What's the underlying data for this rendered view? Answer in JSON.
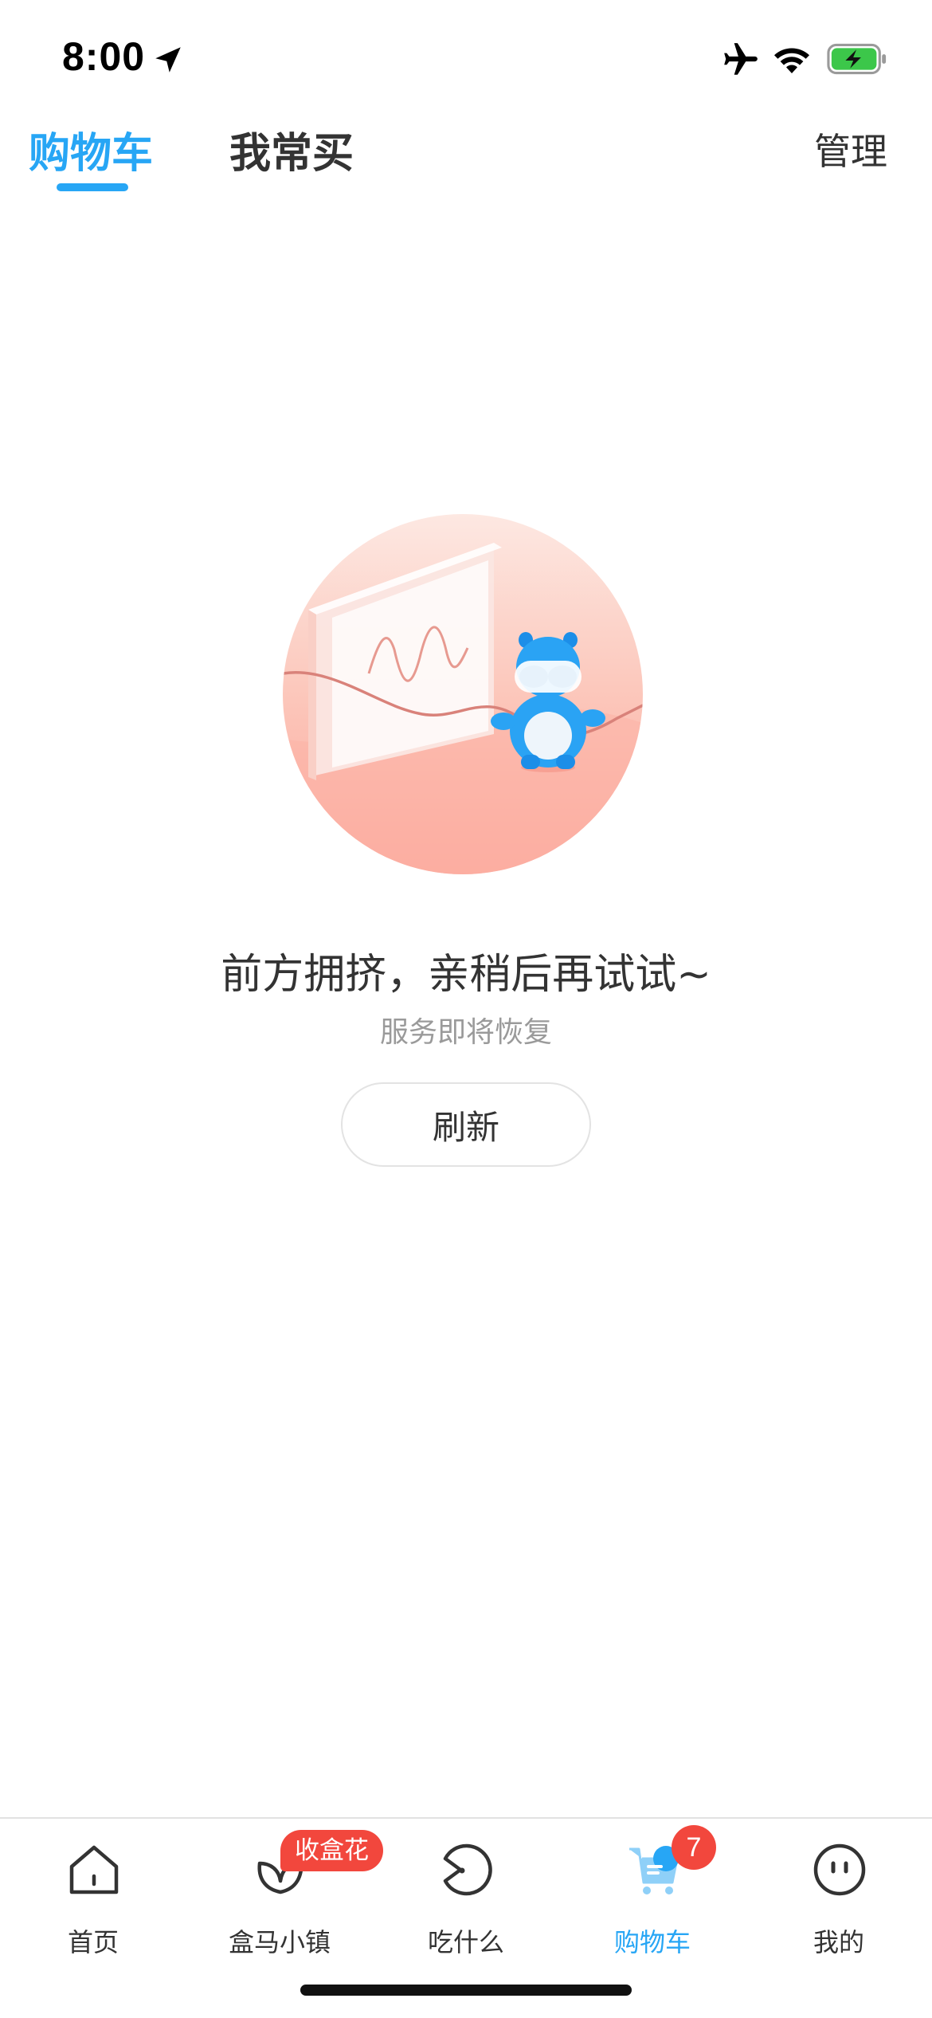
{
  "status_bar": {
    "time": "8:00",
    "icons": [
      "location-arrow-icon",
      "airplane-icon",
      "wifi-icon",
      "battery-charging-icon"
    ],
    "battery_color": "#3cc74a"
  },
  "header": {
    "tabs": [
      {
        "label": "购物车",
        "active": true
      },
      {
        "label": "我常买",
        "active": false
      }
    ],
    "manage_label": "管理",
    "accent_color": "#27a6f5"
  },
  "empty_state": {
    "title": "前方拥挤，亲稍后再试试~",
    "subtitle": "服务即将恢复",
    "refresh_label": "刷新"
  },
  "tabbar": {
    "items": [
      {
        "label": "首页",
        "icon": "home-icon",
        "active": false
      },
      {
        "label": "盒马小镇",
        "icon": "leaf-icon",
        "active": false,
        "badge": "收盒花"
      },
      {
        "label": "吃什么",
        "icon": "pacman-icon",
        "active": false
      },
      {
        "label": "购物车",
        "icon": "cart-icon",
        "active": true,
        "badge": "7"
      },
      {
        "label": "我的",
        "icon": "face-icon",
        "active": false
      }
    ],
    "badge_color": "#f2473d"
  }
}
